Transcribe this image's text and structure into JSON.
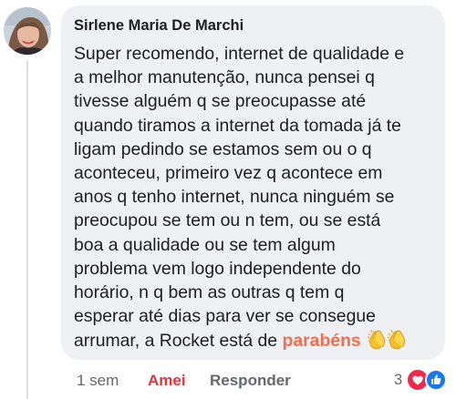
{
  "comment": {
    "author": "Sirlene Maria De Marchi",
    "text_lines": [
      "Super recomendo, internet de qualidade e",
      "a melhor manutenção, nunca pensei q",
      "tivesse alguém q se preocupasse até",
      "quando tiramos a internet da tomada já te",
      "ligam pedindo se estamos sem ou o q",
      "aconteceu, primeiro vez q acontece em",
      "anos q tenho internet, nunca ninguém se",
      "preocupou se tem ou n tem, ou se está",
      "boa a qualidade ou se tem algum",
      "problema vem logo independente do",
      "horário, n q bem as outras q tem q",
      "esperar até dias para ver se consegue",
      "arrumar, a Rocket está de"
    ],
    "highlight_word": "parabéns",
    "emoji": "clapping-hands-emoji"
  },
  "actions": {
    "time": "1 sem",
    "like_label": "Amei",
    "reply_label": "Responder"
  },
  "reactions": {
    "count": "3",
    "icons": [
      "love-reaction-icon",
      "like-reaction-icon"
    ]
  },
  "colors": {
    "bubble_bg": "#eef0f3",
    "text": "#1c1e21",
    "secondary": "#65676b",
    "love": "#e0373e",
    "highlight": "#ef6f4f",
    "like_blue": "#1877f2"
  }
}
